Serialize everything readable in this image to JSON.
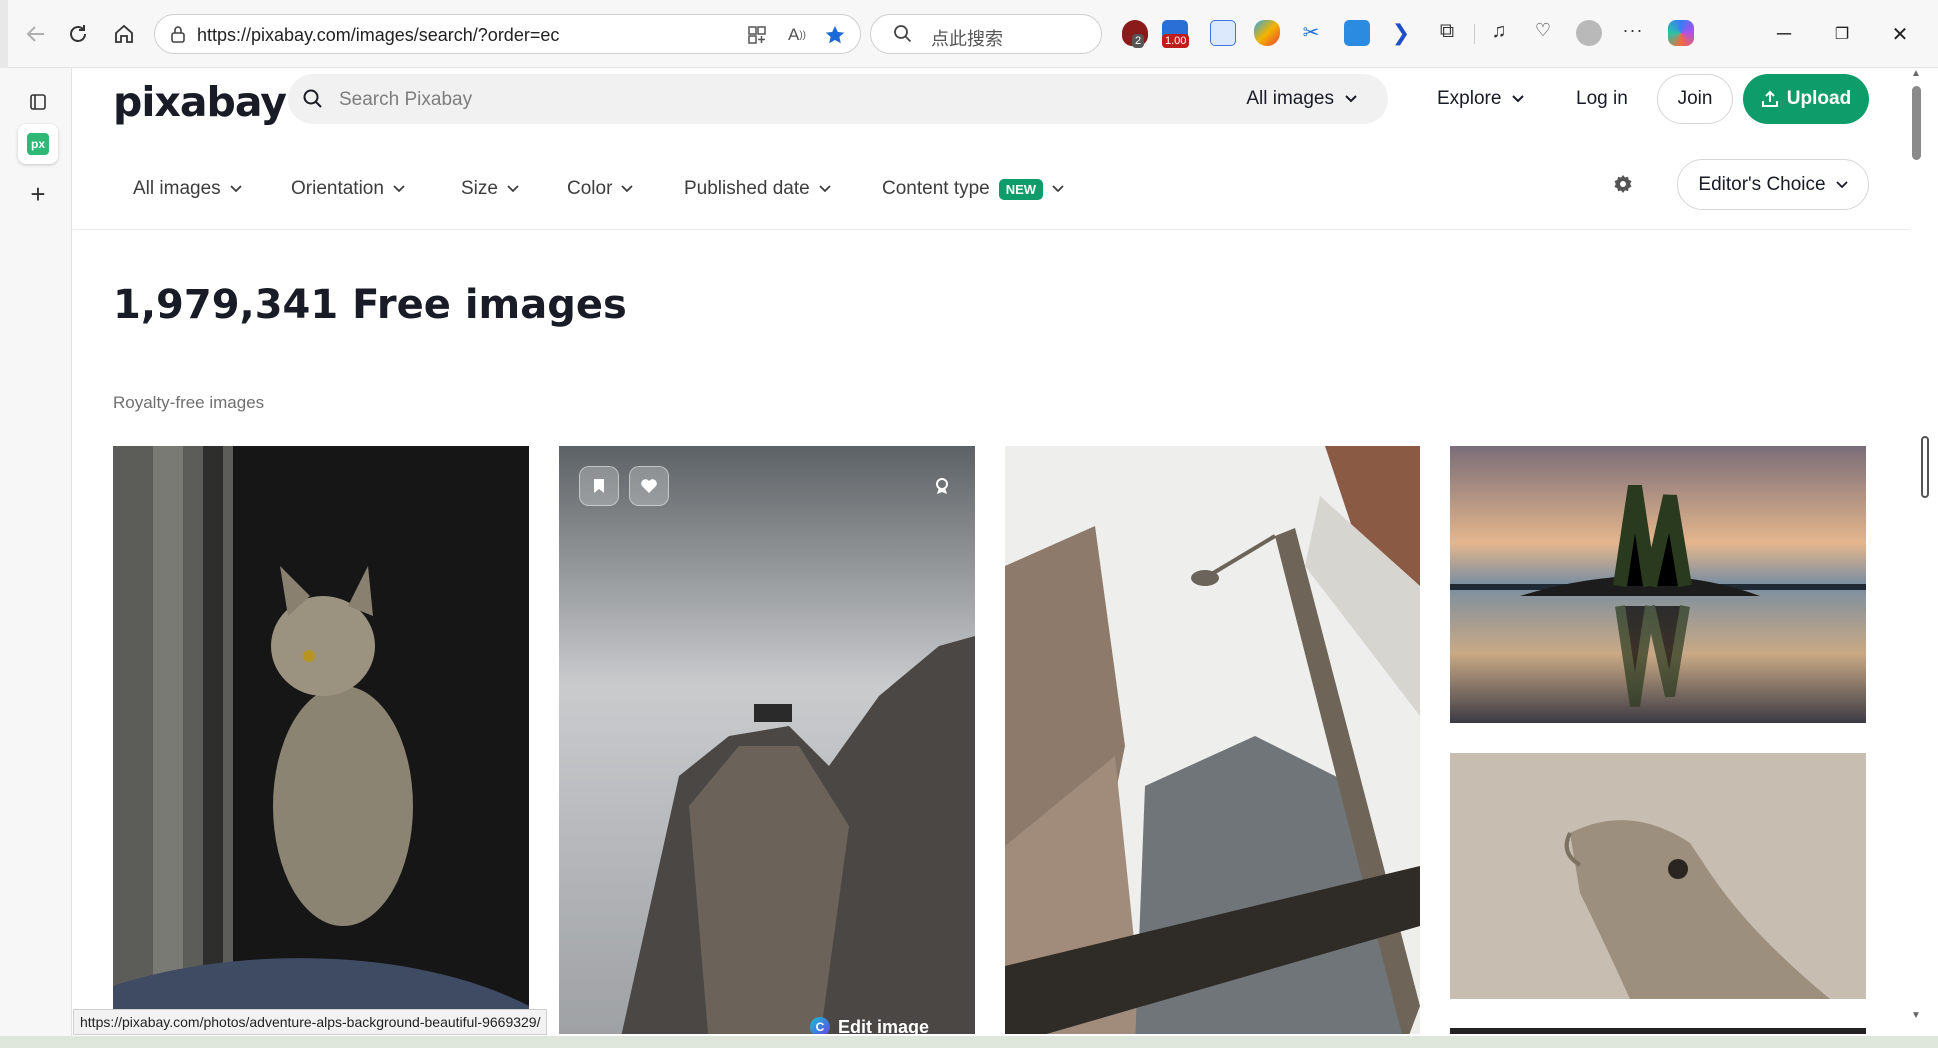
{
  "browser": {
    "url": "https://pixabay.com/images/search/?order=ec",
    "search_placeholder": "点此搜索",
    "ext_badge_1": "2",
    "ext_badge_2": "1.00",
    "status_url": "https://pixabay.com/photos/adventure-alps-background-beautiful-9669329/"
  },
  "header": {
    "logo": "pixabay",
    "search_placeholder": "Search Pixabay",
    "search_scope": "All images",
    "explore": "Explore",
    "login": "Log in",
    "join": "Join",
    "upload": "Upload"
  },
  "filters": {
    "items": [
      "All images",
      "Orientation",
      "Size",
      "Color",
      "Published date",
      "Content type"
    ],
    "new_badge": "NEW",
    "sort": "Editor's Choice"
  },
  "main": {
    "title": "1,979,341 Free images",
    "subtitle": "Royalty-free images",
    "edit_image": "Edit image"
  },
  "colors": {
    "brand": "#0e9d6a",
    "text": "#191b26"
  }
}
